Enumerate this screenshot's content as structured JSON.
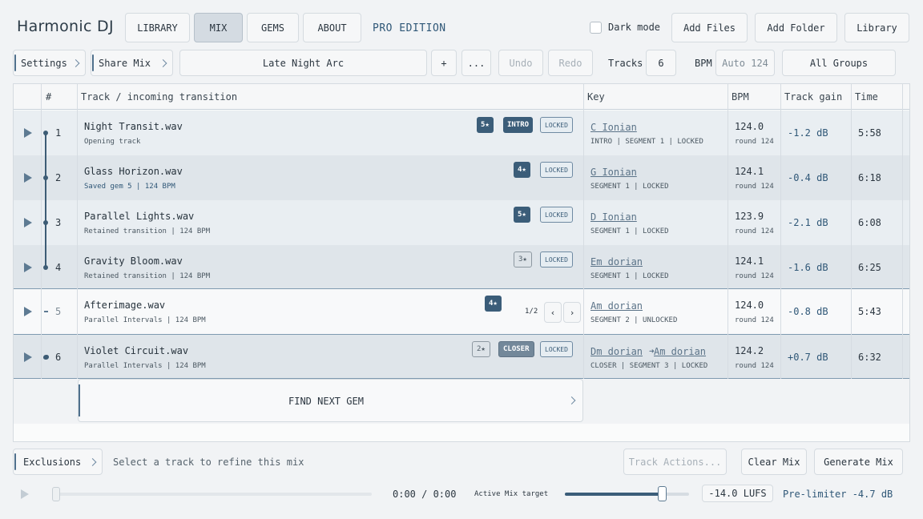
{
  "app": {
    "title": "Harmonic DJ",
    "edition": "PRO EDITION"
  },
  "nav": {
    "tabs": [
      {
        "label": "LIBRARY",
        "active": false
      },
      {
        "label": "MIX",
        "active": true
      },
      {
        "label": "GEMS",
        "active": false
      },
      {
        "label": "ABOUT",
        "active": false
      }
    ]
  },
  "top_right": {
    "dark_mode_label": "Dark mode",
    "dark_mode_checked": false,
    "add_files": "Add Files",
    "add_folder": "Add Folder",
    "library": "Library"
  },
  "toolbar": {
    "settings": "Settings",
    "share_mix": "Share Mix",
    "mix_name": "Late Night Arc",
    "plus": "+",
    "more": "...",
    "undo": "Undo",
    "redo": "Redo",
    "tracks_label": "Tracks",
    "tracks_value": "6",
    "bpm_label": "BPM",
    "bpm_placeholder": "Auto 124",
    "groups": "All Groups"
  },
  "table": {
    "headers": {
      "index": "#",
      "track": "Track / incoming transition",
      "key": "Key",
      "bpm": "BPM",
      "gain": "Track gain",
      "time": "Time"
    },
    "rows": [
      {
        "num": "1",
        "title": "Night Transit.wav",
        "sub": "Opening track",
        "stars": "5★",
        "tag": "INTRO",
        "locked": "LOCKED",
        "key": "C Ionian",
        "key_sub": "INTRO | SEGMENT 1 | LOCKED",
        "bpm": "124.0",
        "bpm_sub": "round 124",
        "gain": "-1.2 dB",
        "time": "5:58"
      },
      {
        "num": "2",
        "title": "Glass Horizon.wav",
        "sub": "Saved gem 5 | 124 BPM",
        "stars": "4★",
        "locked": "LOCKED",
        "key": "G Ionian",
        "key_sub": "SEGMENT 1 | LOCKED",
        "bpm": "124.1",
        "bpm_sub": "round 124",
        "gain": "-0.4 dB",
        "time": "6:18"
      },
      {
        "num": "3",
        "title": "Parallel Lights.wav",
        "sub": "Retained transition | 124 BPM",
        "stars": "5★",
        "locked": "LOCKED",
        "key": "D Ionian",
        "key_sub": "SEGMENT 1 | LOCKED",
        "bpm": "123.9",
        "bpm_sub": "round 124",
        "gain": "-2.1 dB",
        "time": "6:08"
      },
      {
        "num": "4",
        "title": "Gravity Bloom.wav",
        "sub": "Retained transition | 124 BPM",
        "stars": "3★",
        "locked": "LOCKED",
        "key": "Em dorian",
        "key_sub": "SEGMENT 1 | LOCKED",
        "bpm": "124.1",
        "bpm_sub": "round 124",
        "gain": "-1.6 dB",
        "time": "6:25"
      },
      {
        "num": "5",
        "title": "Afterimage.wav",
        "sub": "Parallel Intervals | 124 BPM",
        "stars": "4★",
        "pager": "1/2",
        "pager_prev": "‹",
        "pager_next": "›",
        "key": "Am dorian",
        "key_sub": "SEGMENT 2 | UNLOCKED",
        "bpm": "124.0",
        "bpm_sub": "round 124",
        "gain": "-0.8 dB",
        "time": "5:43"
      },
      {
        "num": "6",
        "title": "Violet Circuit.wav",
        "sub": "Parallel Intervals | 124 BPM",
        "stars": "2★",
        "tag": "CLOSER",
        "locked": "LOCKED",
        "key_from": "Dm dorian",
        "key_arrow": "➜",
        "key": "Am dorian",
        "key_sub": "CLOSER | SEGMENT 3 | LOCKED",
        "bpm": "124.2",
        "bpm_sub": "round 124",
        "gain": "+0.7 dB",
        "time": "6:32"
      }
    ],
    "find_next": "FIND NEXT GEM"
  },
  "bottom": {
    "exclusions": "Exclusions",
    "hint": "Select a track to refine this mix",
    "track_actions": "Track Actions...",
    "clear_mix": "Clear Mix",
    "generate_mix": "Generate Mix"
  },
  "player": {
    "time": "0:00 / 0:00",
    "target_label": "Active Mix target",
    "volume_level": 0.78,
    "lufs": "-14.0 LUFS",
    "pre_limiter": "Pre-limiter -4.7 dB"
  }
}
